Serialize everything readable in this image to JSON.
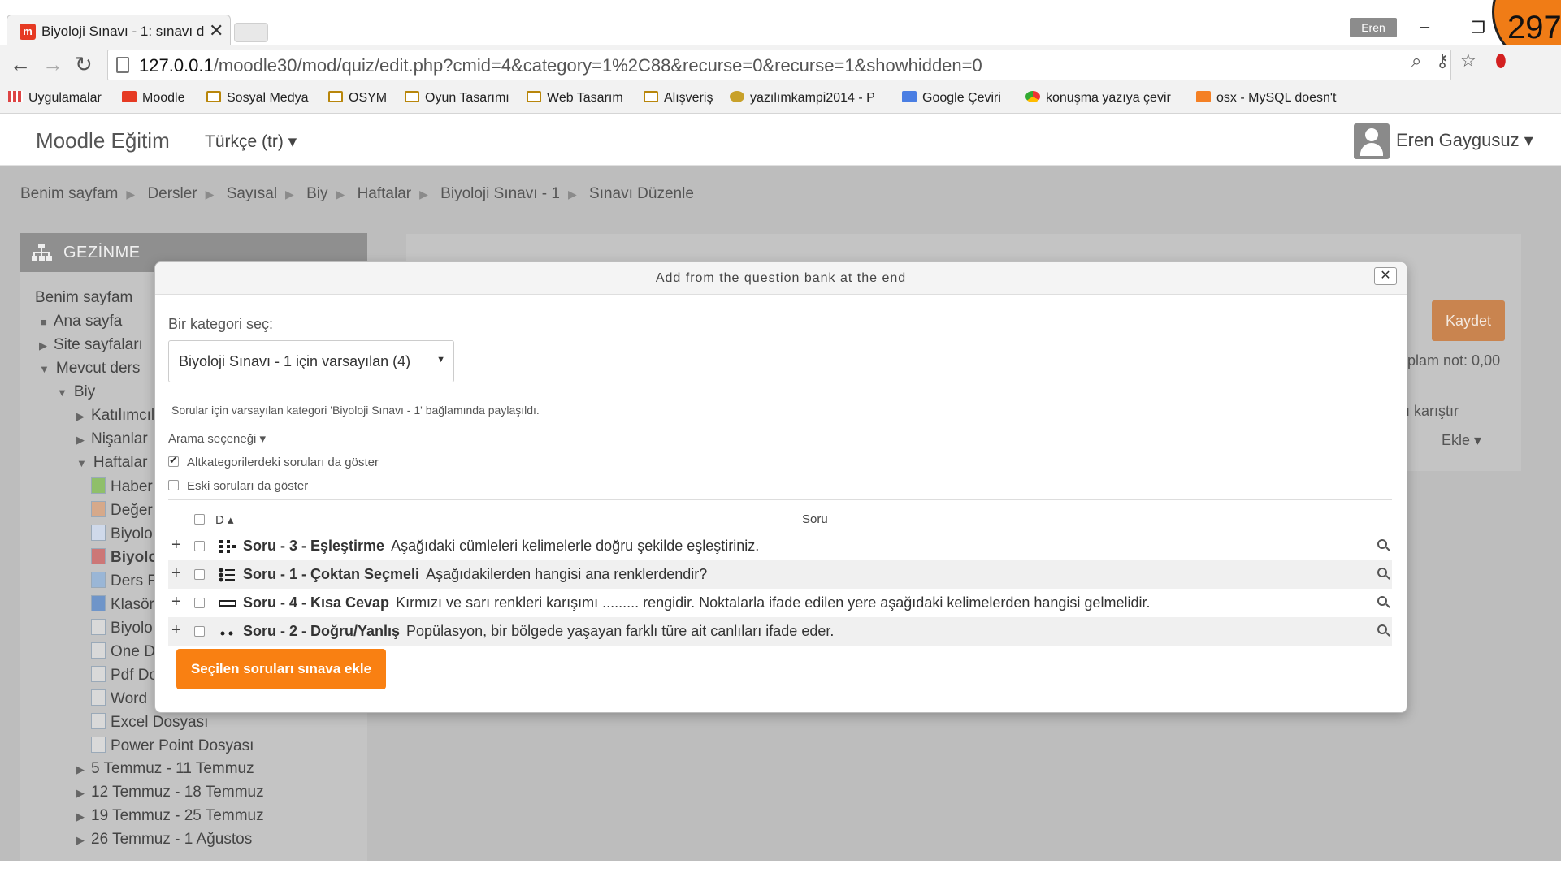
{
  "browser": {
    "tab_title": "Biyoloji Sınavı - 1: sınavı d",
    "tab_close": "✕",
    "favicon_letter": "m",
    "user_chip": "Eren",
    "url_host": "127.0.0.1",
    "url_path": "/moodle30/mod/quiz/edit.php?cmid=4&category=1%2C88&recurse=0&recurse=1&showhidden=0",
    "badge_number": "297",
    "bookmarks": [
      "Uygulamalar",
      "Moodle",
      "Sosyal Medya",
      "OSYM",
      "Oyun Tasarımı",
      "Web Tasarım",
      "Alışveriş",
      "yazılımkampi2014 - P",
      "Google Çeviri",
      "konuşma yazıya çevir",
      "osx - MySQL doesn't"
    ]
  },
  "navbar": {
    "brand": "Moodle Eğitim",
    "language": "Türkçe (tr) ▾",
    "username": "Eren Gaygusuz ▾"
  },
  "breadcrumb": [
    "Benim sayfam",
    "Dersler",
    "Sayısal",
    "Biy",
    "Haftalar",
    "Biyoloji Sınavı - 1",
    "Sınavı Düzenle"
  ],
  "nav_block": {
    "title": "GEZİNME",
    "items": [
      "Benim sayfam",
      "Ana sayfa",
      "Site sayfaları",
      "Mevcut ders",
      "Biy",
      "Katılımcıl",
      "Nişanlar",
      "Haftalar",
      "Haber",
      "Değer",
      "Biyolo",
      "Biyolo",
      "Ders F",
      "Klasör",
      "Biyolo",
      "One D",
      "Pdf Do",
      "Word",
      "Excel Dosyası",
      "Power Point Dosyası",
      "5 Temmuz - 11 Temmuz",
      "12 Temmuz - 18 Temmuz",
      "19 Temmuz - 25 Temmuz",
      "26 Temmuz - 1 Ağustos"
    ]
  },
  "edit_page": {
    "save_label": "Kaydet",
    "total_label": "oplam not: 0,00",
    "shuffle_label": "ı karıştır",
    "add_label": "Ekle ▾"
  },
  "modal": {
    "title": "Add from the question bank at the end",
    "close": "✕",
    "category_label": "Bir kategori seç:",
    "category_value": "Biyoloji Sınavı - 1 için varsayılan (4)",
    "category_note": "Sorular için varsayılan kategori 'Biyoloji Sınavı - 1' bağlamında paylaşıldı.",
    "search_options": "Arama seçeneği ▾",
    "opt_subcategories": "Altkategorilerdeki soruları da göster",
    "opt_old": "Eski soruları da göster",
    "col_d": "D ▴",
    "col_soru": "Soru",
    "questions": [
      {
        "name": "Soru - 3 - Eşleştirme",
        "text": "Aşağıdaki cümleleri kelimelerle doğru şekilde eşleştiriniz."
      },
      {
        "name": "Soru - 1 - Çoktan Seçmeli",
        "text": "Aşağıdakilerden hangisi ana renklerdendir?"
      },
      {
        "name": "Soru - 4 - Kısa Cevap",
        "text": "Kırmızı ve sarı renkleri karışımı ......... rengidir. Noktalarla ifade edilen yere aşağıdaki kelimelerden hangisi gelmelidir."
      },
      {
        "name": "Soru - 2 - Doğru/Yanlış",
        "text": "Popülasyon, bir bölgede yaşayan farklı türe ait canlıları ifade eder."
      }
    ],
    "add_button": "Seçilen soruları sınava ekle"
  }
}
